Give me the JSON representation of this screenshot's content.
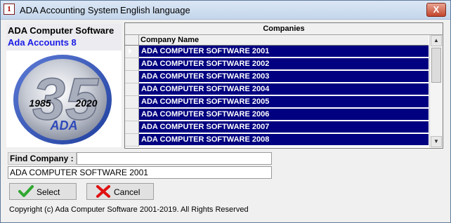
{
  "window": {
    "title": "ADA Accounting System",
    "language": "English language",
    "icon": "app-icon",
    "icon_text": "1",
    "close_label": "X"
  },
  "brand": {
    "company": "ADA Computer Software",
    "product": "Ada Accounts 8",
    "logo": {
      "number": "35",
      "year_start": "1985",
      "year_end": "2020",
      "caption": "ADA"
    }
  },
  "companies": {
    "caption": "Companies",
    "column_header": "Company Name",
    "rows": [
      "ADA COMPUTER SOFTWARE 2001",
      "ADA COMPUTER SOFTWARE 2002",
      "ADA COMPUTER SOFTWARE 2003",
      "ADA COMPUTER SOFTWARE 2004",
      "ADA COMPUTER SOFTWARE 2005",
      "ADA COMPUTER SOFTWARE 2006",
      "ADA COMPUTER SOFTWARE 2007",
      "ADA COMPUTER SOFTWARE 2008"
    ]
  },
  "find": {
    "label": "Find Company :",
    "value": ""
  },
  "selected_company": "ADA COMPUTER SOFTWARE 2001",
  "buttons": {
    "select": "Select",
    "cancel": "Cancel"
  },
  "footer": {
    "copyright": "Copyright (c) Ada Computer Software 2001-2019.  All Rights Reserved"
  },
  "colors": {
    "row_highlight": "#000080",
    "product_text": "#1a1ae6",
    "logo_blue": "#1f3f9e"
  }
}
